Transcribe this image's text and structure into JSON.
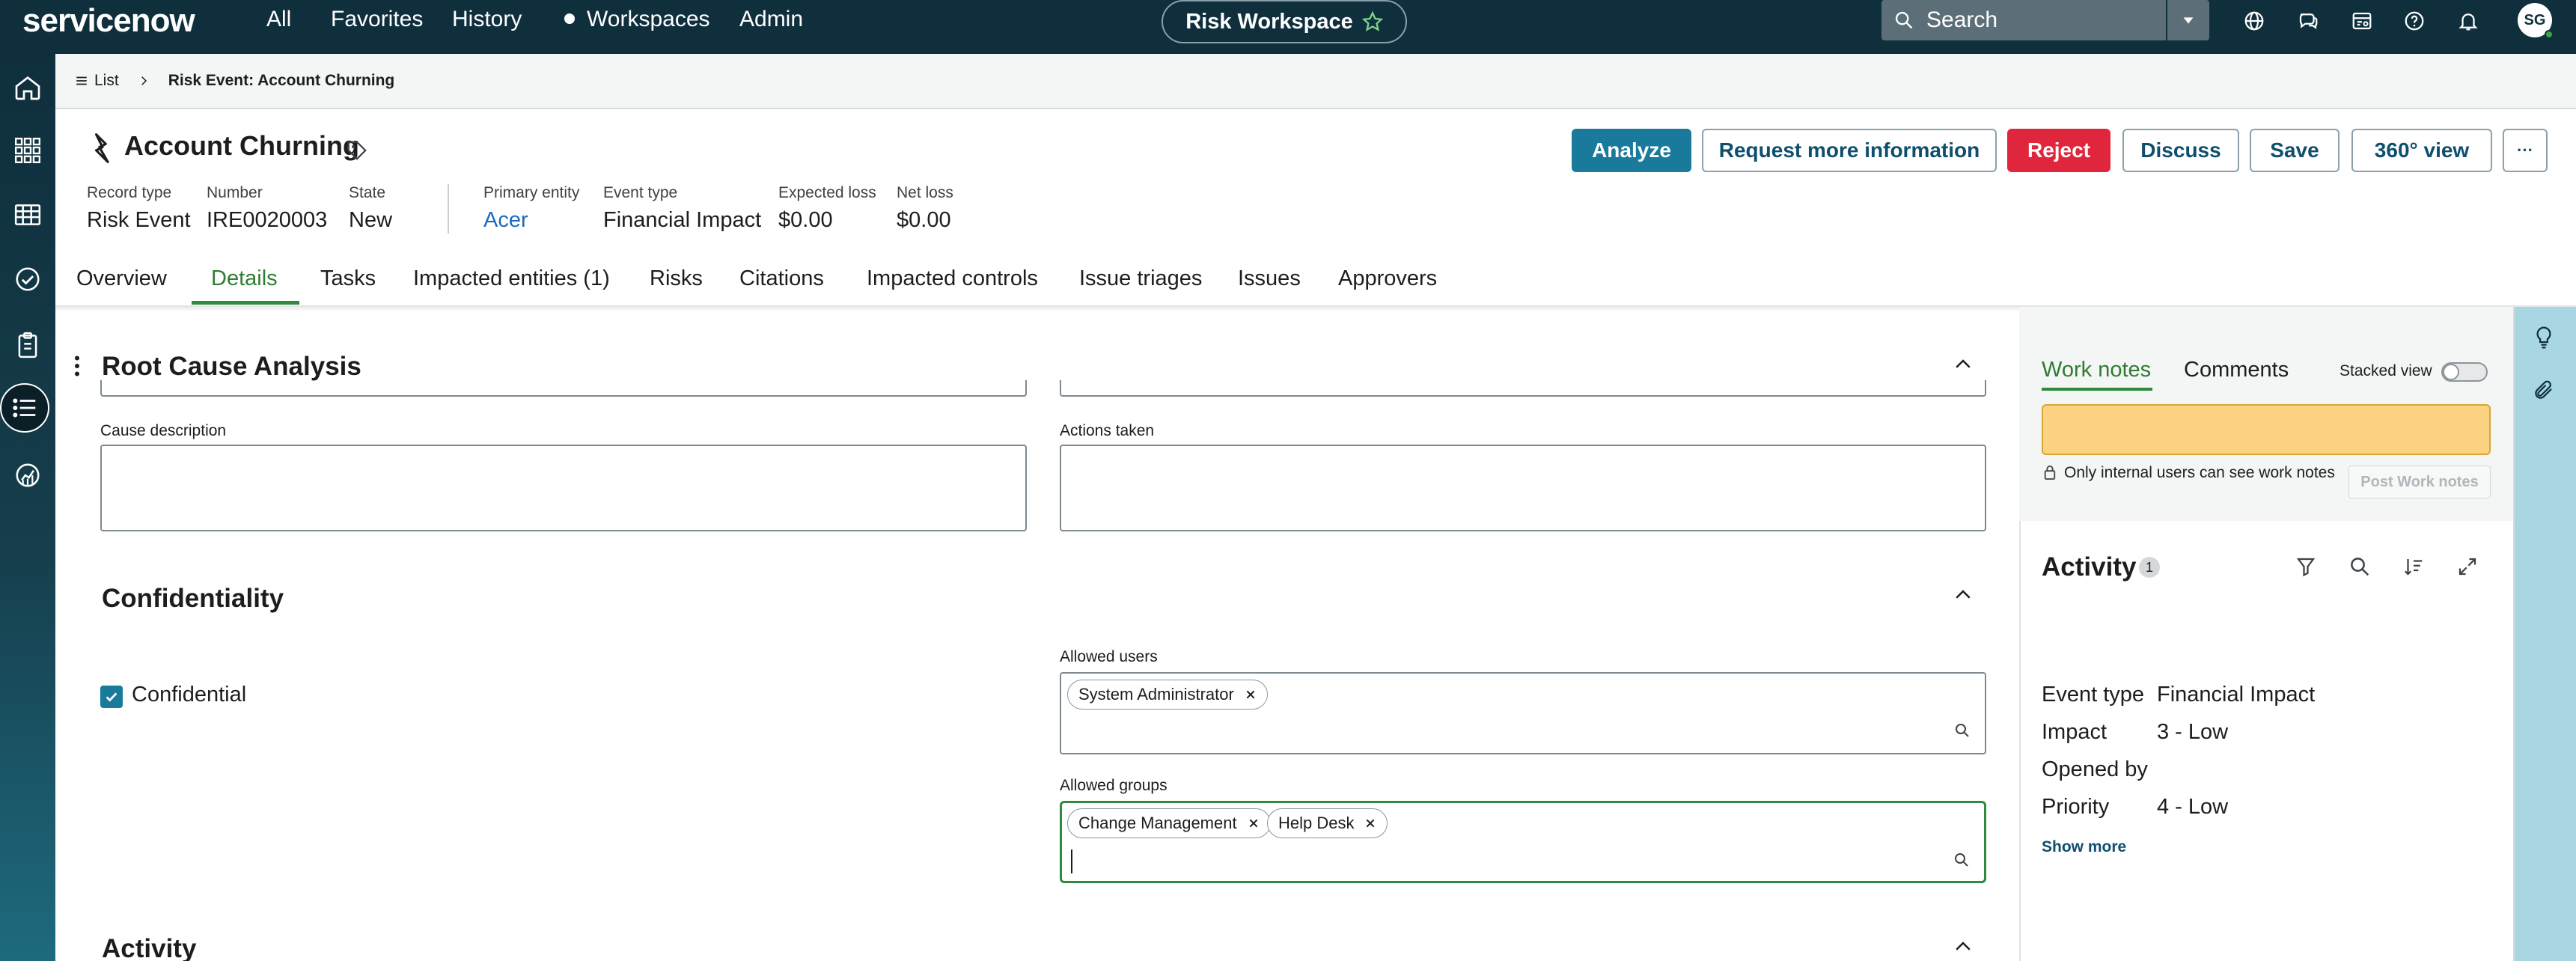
{
  "topnav": {
    "logo": "servicenow",
    "links": [
      "All",
      "Favorites",
      "History",
      "Workspaces",
      "Admin"
    ],
    "workspace": "Risk Workspace",
    "search_placeholder": "Search",
    "avatar_initials": "SG"
  },
  "breadcrumb": {
    "list_label": "List",
    "current": "Risk Event: Account Churning"
  },
  "record": {
    "title": "Account Churning",
    "meta": [
      {
        "label": "Record type",
        "value": "Risk Event"
      },
      {
        "label": "Number",
        "value": "IRE0020003"
      },
      {
        "label": "State",
        "value": "New"
      },
      {
        "label": "Primary entity",
        "value": "Acer"
      },
      {
        "label": "Event type",
        "value": "Financial Impact"
      },
      {
        "label": "Expected loss",
        "value": "$0.00"
      },
      {
        "label": "Net loss",
        "value": "$0.00"
      }
    ],
    "actions": {
      "analyze": "Analyze",
      "request_info": "Request more information",
      "reject": "Reject",
      "discuss": "Discuss",
      "save": "Save",
      "view360": "360° view",
      "more": "···"
    }
  },
  "tabs": [
    "Overview",
    "Details",
    "Tasks",
    "Impacted entities (1)",
    "Risks",
    "Citations",
    "Impacted controls",
    "Issue triages",
    "Issues",
    "Approvers"
  ],
  "active_tab": "Details",
  "form": {
    "root_cause_title": "Root Cause Analysis",
    "cause_description_label": "Cause description",
    "actions_taken_label": "Actions taken",
    "confidentiality_title": "Confidentiality",
    "confidential_label": "Confidential",
    "confidential_checked": true,
    "allowed_users_label": "Allowed users",
    "allowed_users": [
      "System Administrator"
    ],
    "allowed_groups_label": "Allowed groups",
    "allowed_groups": [
      "Change Management",
      "Help Desk"
    ],
    "activity_title": "Activity"
  },
  "right_panel": {
    "tab_worknotes": "Work notes",
    "tab_comments": "Comments",
    "stacked_view_label": "Stacked view",
    "visibility_note": "Only internal users can see work notes",
    "post_button": "Post Work notes",
    "activity_title": "Activity",
    "activity_count": "1",
    "fields": [
      {
        "label": "Event type",
        "value": "Financial Impact"
      },
      {
        "label": "Impact",
        "value": "3 - Low"
      },
      {
        "label": "Opened by",
        "value": ""
      },
      {
        "label": "Priority",
        "value": "4 - Low"
      }
    ],
    "show_more": "Show more"
  },
  "colors": {
    "nav_bg": "#0f2f3d",
    "primary_button": "#1a7a9c",
    "danger_button": "#e0263d",
    "active_tab": "#2e8b3e",
    "work_notes_input": "#fbd382"
  }
}
